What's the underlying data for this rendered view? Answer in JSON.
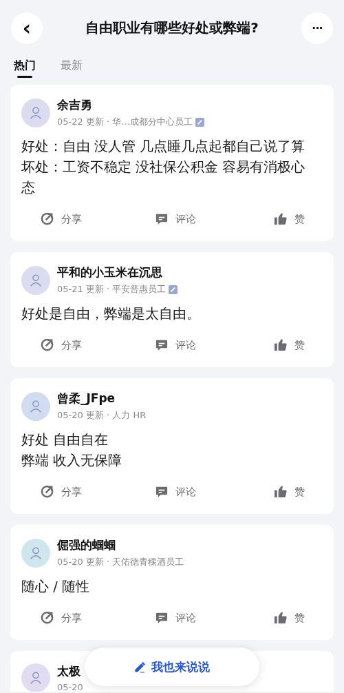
{
  "header": {
    "back": "‹",
    "title": "自由职业有哪些好处或弊端?",
    "more": "···"
  },
  "tabs": [
    {
      "label": "热门",
      "selected": true
    },
    {
      "label": "最新",
      "selected": false
    }
  ],
  "posts": [
    {
      "author": "余吉勇",
      "meta": "05-22 更新 · 华…成都分中心员工",
      "verified": true,
      "color": "#dcdcf0",
      "body": [
        "好处：自由 没人管 几点睡几点起都自己说了算",
        "坏处：工资不稳定 没社保公积金 容易有消极心态"
      ],
      "actions": [
        "分享",
        "评论",
        "赞"
      ]
    },
    {
      "author": "平和的小玉米在沉思",
      "meta": "05-21 更新 · 平安普惠员工",
      "verified": true,
      "color": "#dcdcf0",
      "body": [
        "好处是自由，弊端是太自由。"
      ],
      "actions": [
        "分享",
        "评论",
        "赞"
      ]
    },
    {
      "author": "曾柔_JFpe",
      "meta": "05-20 更新 · 人力 HR",
      "verified": false,
      "color": "#d2dcf0",
      "body": [
        "好处 自由自在",
        "弊端 收入无保障"
      ],
      "actions": [
        "分享",
        "评论",
        "赞"
      ]
    },
    {
      "author": "倔强的蝈蝈",
      "meta": "05-20 更新 · 天佑德青稞酒员工",
      "verified": false,
      "color": "#cfe6ee",
      "body": [
        "随心 / 随性"
      ],
      "actions": [
        "分享",
        "评论",
        "赞"
      ]
    },
    {
      "author": "太极",
      "meta": "05-20",
      "verified": false,
      "color": "#e2dcf2"
    }
  ],
  "fab": {
    "label": "我也来说说"
  }
}
